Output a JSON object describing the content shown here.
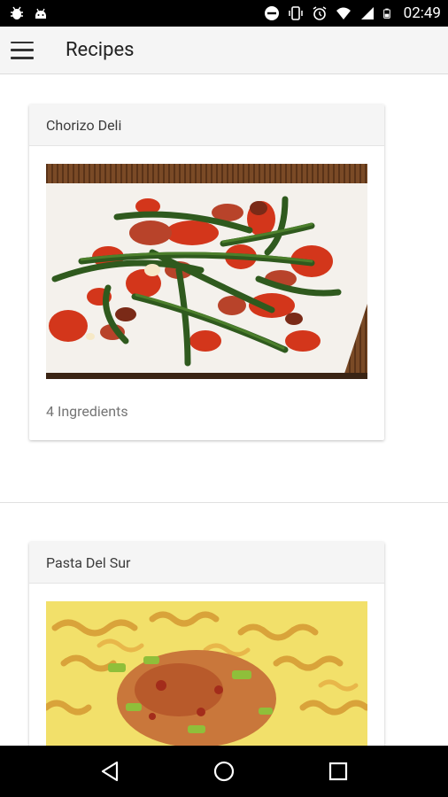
{
  "status_bar": {
    "time": "02:49",
    "icons_left": [
      "bug-icon",
      "android-icon"
    ],
    "icons_right": [
      "dnd-icon",
      "vibrate-icon",
      "alarm-icon",
      "wifi-icon",
      "cell-signal-icon",
      "battery-icon"
    ]
  },
  "toolbar": {
    "title": "Recipes",
    "menu_icon": "hamburger-menu-icon"
  },
  "recipes": [
    {
      "name": "Chorizo Deli",
      "ingredients": "4 Ingredients",
      "image": "chorizo-green-beans-photo"
    },
    {
      "name": "Pasta Del Sur",
      "image": "fusilli-pasta-photo"
    }
  ],
  "nav_bar": {
    "icons": [
      "back-icon",
      "home-icon",
      "recents-icon"
    ]
  },
  "colors": {
    "status_bar": "#000000",
    "toolbar": "#f5f5f5",
    "card_header": "#f5f5f5"
  }
}
